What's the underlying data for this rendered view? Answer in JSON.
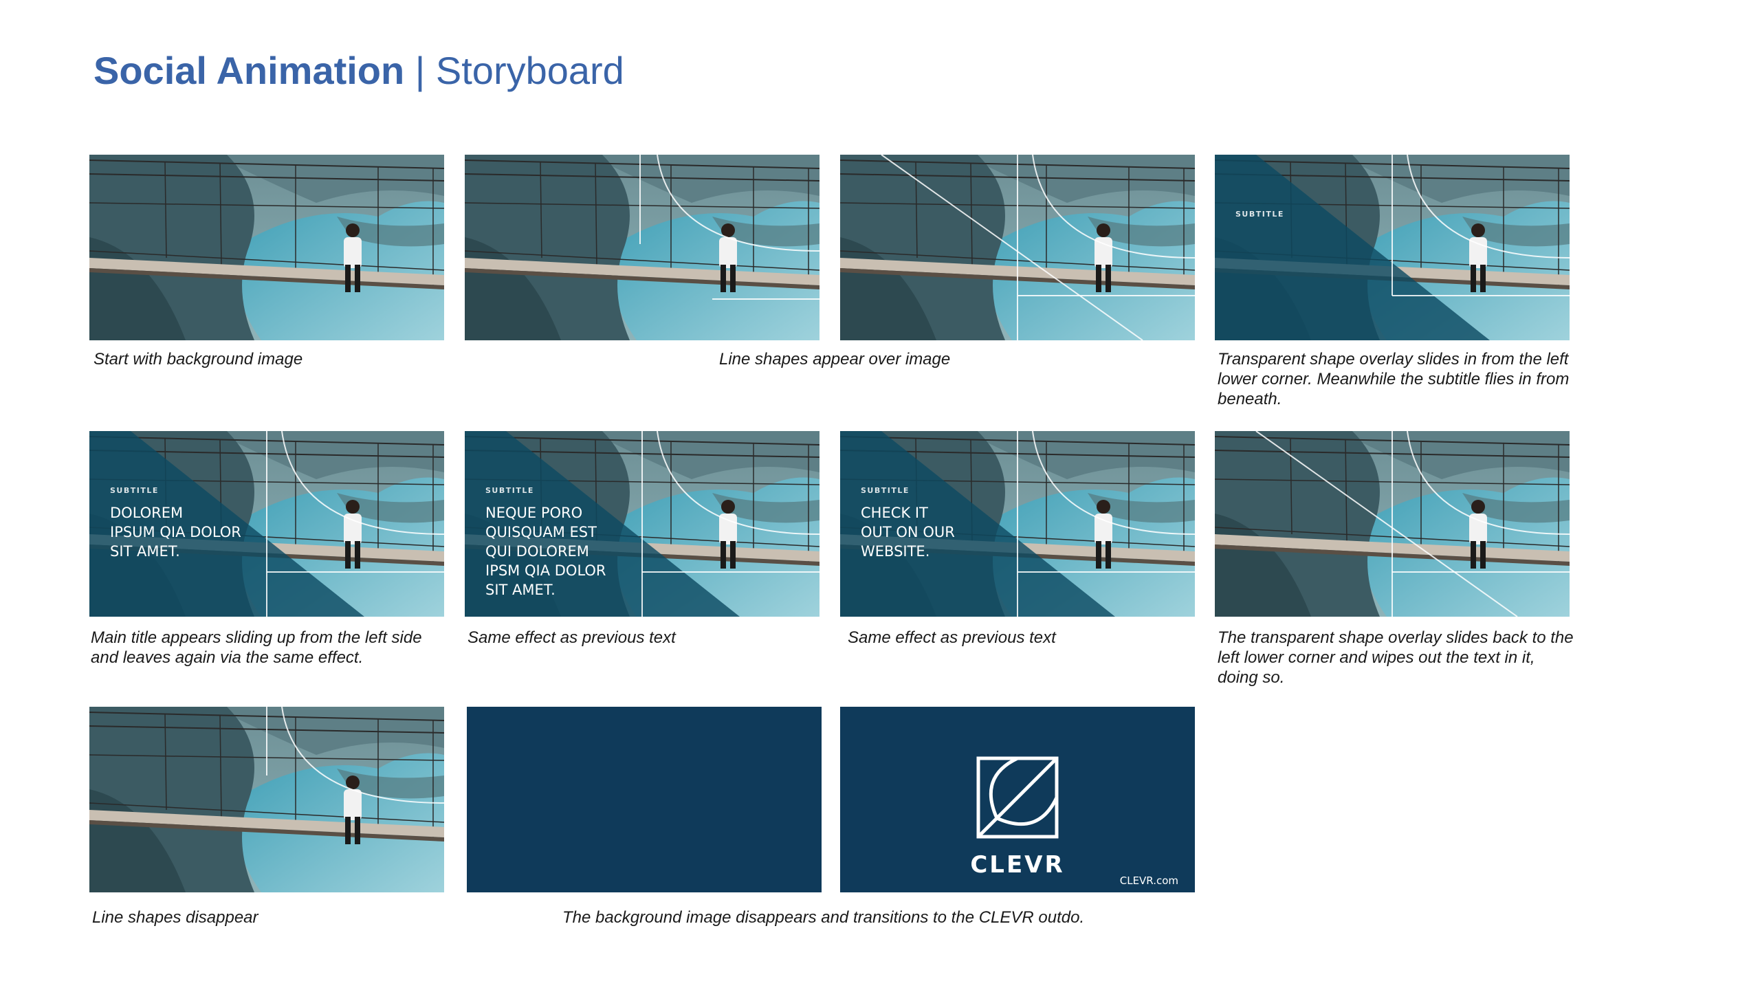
{
  "header": {
    "title_bold": "Social Animation",
    "title_rest": " | Storyboard"
  },
  "frames": {
    "f4": {
      "subtitle": "SUBTITLE"
    },
    "f5": {
      "subtitle": "SUBTITLE",
      "title": "DOLOREM\nIPSUM QIA DOLOR\nSIT AMET."
    },
    "f6": {
      "subtitle": "SUBTITLE",
      "title": "NEQUE PORO\nQUISQUAM EST\nQUI DOLOREM\nIPSM QIA DOLOR\nSIT AMET."
    },
    "f7": {
      "subtitle": "SUBTITLE",
      "title": "CHECK IT\nOUT ON OUR\nWEBSITE."
    },
    "outro": {
      "brand": "CLEVR",
      "url": "CLEVR.com"
    }
  },
  "captions": {
    "c1": "Start with background image",
    "c2": "Line shapes appear over image",
    "c3": "Transparent shape overlay slides in from the left lower corner. Meanwhile the subtitle flies in from beneath.",
    "c5": "Main title appears sliding up from the left side and leaves again via the same effect.",
    "c6": "Same effect as previous text",
    "c7": "Same effect as previous text",
    "c8": "The transparent shape overlay slides back to the left lower corner and wipes out the text in it, doing so.",
    "c9": "Line shapes disappear",
    "c10": "The background image disappears and transitions to the CLEVR outdo."
  },
  "colors": {
    "title": "#3a64a8",
    "navy": "#0f3a5a",
    "water": "#4aa8bd",
    "overlay": "#0d4a62"
  }
}
